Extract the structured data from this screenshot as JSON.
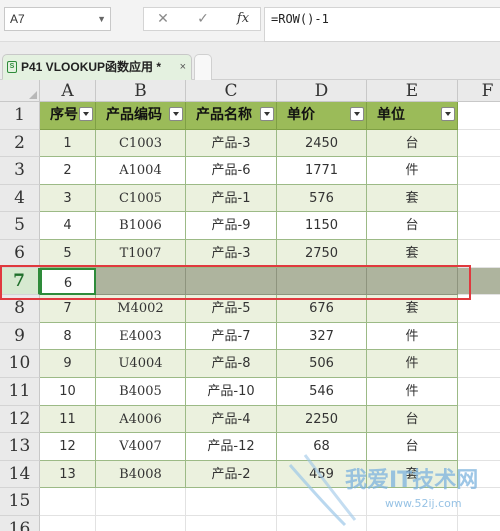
{
  "name_box": "A7",
  "formula": "=ROW()-1",
  "formula_icons": [
    "close-icon",
    "check-icon",
    "fx-icon"
  ],
  "tab": {
    "icon": "S",
    "label": "P41 VLOOKUP函数应用 *",
    "close": "×"
  },
  "columns": [
    "A",
    "B",
    "C",
    "D",
    "E"
  ],
  "partial_column": "F",
  "row_numbers": [
    "1",
    "2",
    "3",
    "4",
    "5",
    "6",
    "7",
    "8",
    "9",
    "10",
    "11",
    "12",
    "13",
    "14",
    "15",
    "16"
  ],
  "headers": [
    "序号",
    "产品编码",
    "产品名称",
    "单价",
    "单位"
  ],
  "rows": [
    [
      "1",
      "C1003",
      "产品-3",
      "2450",
      "台"
    ],
    [
      "2",
      "A1004",
      "产品-6",
      "1771",
      "件"
    ],
    [
      "3",
      "C1005",
      "产品-1",
      "576",
      "套"
    ],
    [
      "4",
      "B1006",
      "产品-9",
      "1150",
      "台"
    ],
    [
      "5",
      "T1007",
      "产品-3",
      "2750",
      "套"
    ],
    [
      "6",
      "",
      "",
      "",
      ""
    ],
    [
      "7",
      "M4002",
      "产品-5",
      "676",
      "套"
    ],
    [
      "8",
      "E4003",
      "产品-7",
      "327",
      "件"
    ],
    [
      "9",
      "U4004",
      "产品-8",
      "506",
      "件"
    ],
    [
      "10",
      "B4005",
      "产品-10",
      "546",
      "件"
    ],
    [
      "11",
      "A4006",
      "产品-4",
      "2250",
      "台"
    ],
    [
      "12",
      "V4007",
      "产品-12",
      "68",
      "台"
    ],
    [
      "13",
      "B4008",
      "产品-2",
      "459",
      "套"
    ]
  ],
  "selected_row": "7",
  "watermark": {
    "text": "我爱IT技术网",
    "url": "www.52ij.com"
  },
  "colors": {
    "header_fill": "#9bbb59",
    "band_fill": "#ebf1de",
    "selection": "#aeb49e",
    "highlight": "#e0393e"
  }
}
